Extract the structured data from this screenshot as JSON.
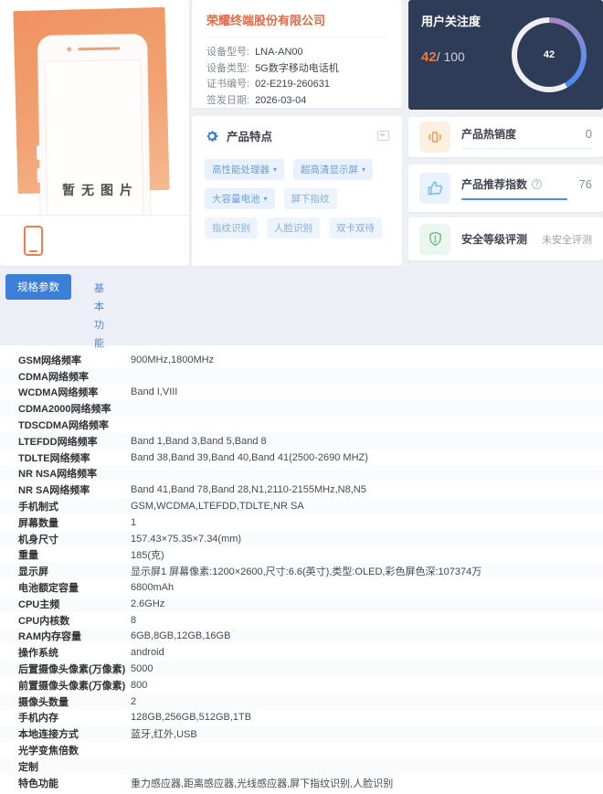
{
  "product_image": {
    "no_image_text": "暂无图片"
  },
  "company": {
    "name": "荣耀终端股份有限公司",
    "fields": [
      {
        "label": "设备型号:",
        "value": "LNA-AN00"
      },
      {
        "label": "设备类型:",
        "value": "5G数字移动电话机"
      },
      {
        "label": "证书编号:",
        "value": "02-E219-260631"
      },
      {
        "label": "签发日期:",
        "value": "2026-03-04"
      }
    ]
  },
  "features": {
    "title": "产品特点",
    "caret_icon": "▾",
    "tags": [
      {
        "label": "高性能处理器",
        "dropdown": true
      },
      {
        "label": "超高清显示屏",
        "dropdown": true
      },
      {
        "label": "大容量电池",
        "dropdown": true
      },
      {
        "label": "屏下指纹",
        "dropdown": false
      },
      {
        "label": "指纹识别",
        "dropdown": false
      },
      {
        "label": "人脸识别",
        "dropdown": false
      },
      {
        "label": "双卡双待",
        "dropdown": false
      }
    ]
  },
  "attention": {
    "title": "用户关注度",
    "score": "42",
    "max_display": "/ 100",
    "gauge_value": "42",
    "accent_color": "#e8793e",
    "card_bg": "#2e3c58",
    "gauge_percent": 42
  },
  "metrics": {
    "hot": {
      "title": "产品热销度",
      "value": "0"
    },
    "recommend": {
      "title": "产品推荐指数",
      "value": "76",
      "help_icon": "?",
      "accent_color": "#4a90e2"
    },
    "security": {
      "title": "安全等级评测",
      "value": "未安全评测"
    }
  },
  "tabs": {
    "spec_button": "规格参数",
    "side_nav": "基本功能"
  },
  "spec_table": {
    "rows": [
      {
        "label": "GSM网络频率",
        "value": "900MHz,1800MHz"
      },
      {
        "label": "CDMA网络频率",
        "value": ""
      },
      {
        "label": "WCDMA网络频率",
        "value": "Band I,VIII"
      },
      {
        "label": "CDMA2000网络频率",
        "value": ""
      },
      {
        "label": "TDSCDMA网络频率",
        "value": ""
      },
      {
        "label": "LTEFDD网络频率",
        "value": "Band 1,Band 3,Band 5,Band 8"
      },
      {
        "label": "TDLTE网络频率",
        "value": "Band 38,Band 39,Band 40,Band 41(2500-2690 MHZ)"
      },
      {
        "label": "NR NSA网络频率",
        "value": ""
      },
      {
        "label": "NR SA网络频率",
        "value": "Band 41,Band 78,Band 28,N1,2110-2155MHz,N8,N5"
      },
      {
        "label": "手机制式",
        "value": "GSM,WCDMA,LTEFDD,TDLTE,NR SA"
      },
      {
        "label": "屏幕数量",
        "value": "1"
      },
      {
        "label": "机身尺寸",
        "value": "157.43×75.35×7.34(mm)"
      },
      {
        "label": "重量",
        "value": "185(克)"
      },
      {
        "label": "显示屏",
        "value": "显示屏1 屏幕像素:1200×2600,尺寸:6.6(英寸),类型:OLED,彩色屏色深:107374万"
      },
      {
        "label": "电池额定容量",
        "value": "6800mAh"
      },
      {
        "label": "CPU主频",
        "value": "2.6GHz"
      },
      {
        "label": "CPU内核数",
        "value": "8"
      },
      {
        "label": "RAM内存容量",
        "value": "6GB,8GB,12GB,16GB"
      },
      {
        "label": "操作系统",
        "value": "android"
      },
      {
        "label": "后置摄像头像素(万像素)",
        "value": "5000"
      },
      {
        "label": "前置摄像头像素(万像素)",
        "value": "800"
      },
      {
        "label": "摄像头数量",
        "value": "2"
      },
      {
        "label": "手机内存",
        "value": "128GB,256GB,512GB,1TB"
      },
      {
        "label": "本地连接方式",
        "value": "蓝牙,红外,USB"
      },
      {
        "label": "光学变焦倍数",
        "value": ""
      },
      {
        "label": "定制",
        "value": ""
      },
      {
        "label": "特色功能",
        "value": "重力感应器,距离感应器,光线感应器,屏下指纹识别,人脸识别"
      }
    ]
  }
}
